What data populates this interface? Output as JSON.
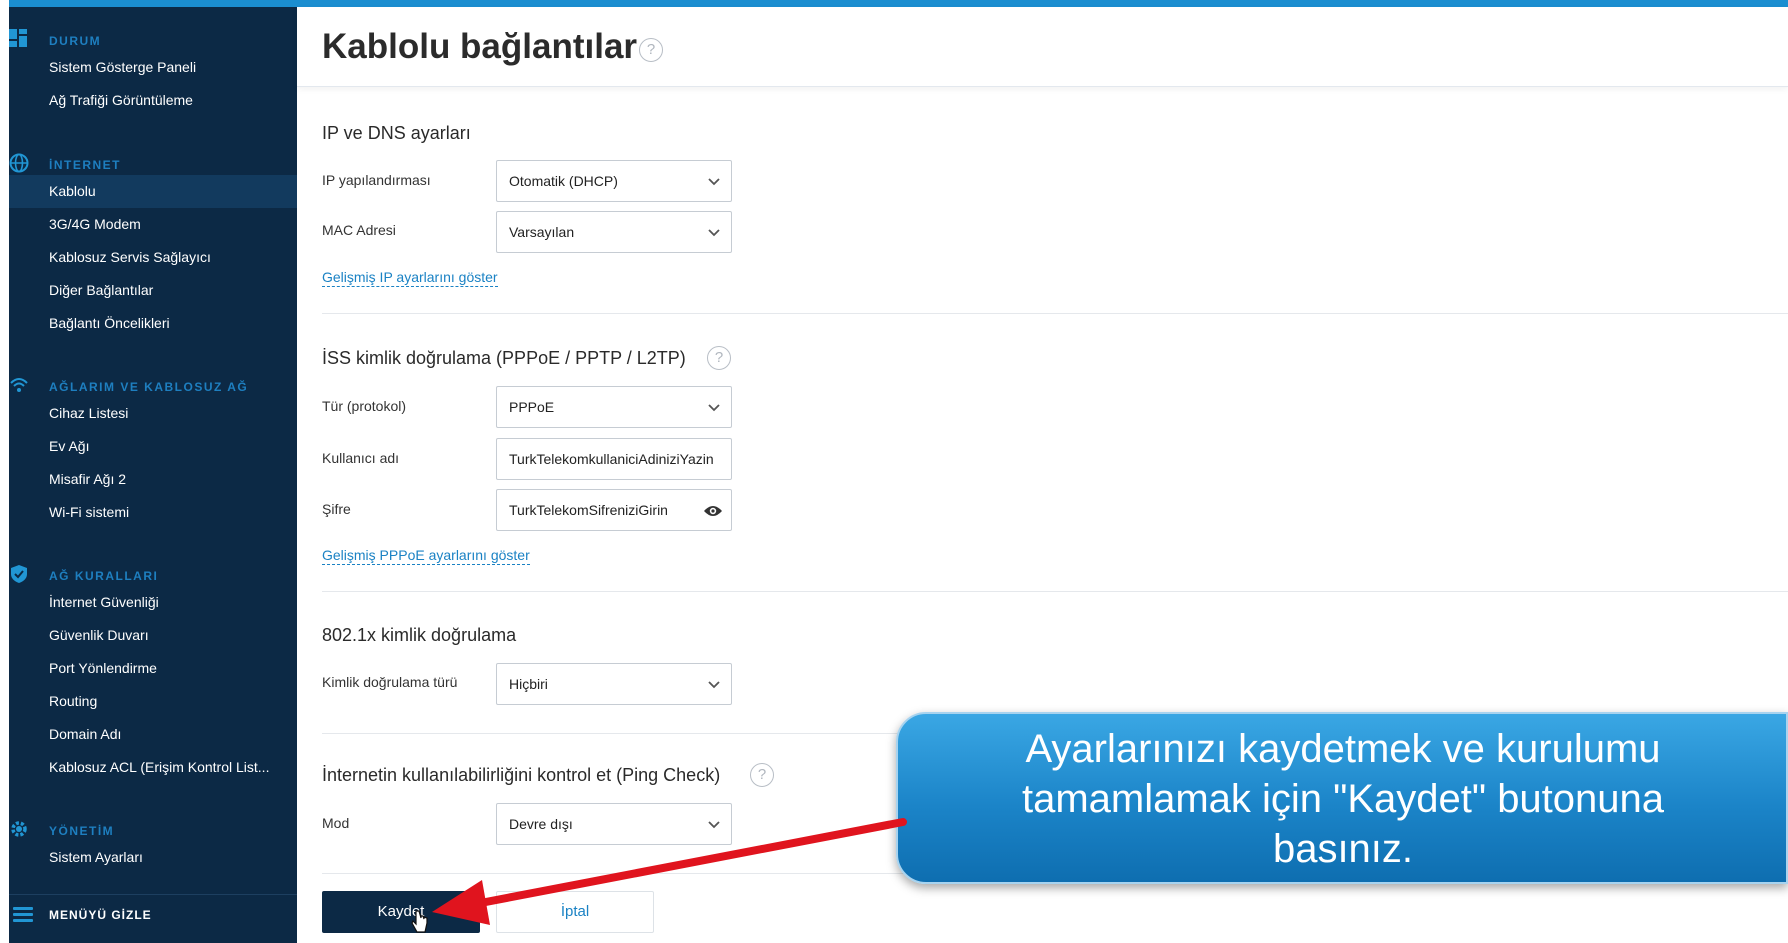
{
  "colors": {
    "sidebar_bg": "#0c2945",
    "accent": "#1b8ed0",
    "section_label": "#1e7fc0",
    "link": "#1a82c4",
    "save_button": "#0c2945"
  },
  "sidebar": {
    "sections": [
      {
        "title": "DURUM",
        "icon": "dashboard-icon",
        "items": [
          "Sistem Gösterge Paneli",
          "Ağ Trafiği Görüntüleme"
        ]
      },
      {
        "title": "İNTERNET",
        "icon": "globe-icon",
        "items": [
          "Kablolu",
          "3G/4G Modem",
          "Kablosuz Servis Sağlayıcı",
          "Diğer Bağlantılar",
          "Bağlantı Öncelikleri"
        ]
      },
      {
        "title": "AĞLARIM VE KABLOSUZ AĞ",
        "icon": "wifi-icon",
        "items": [
          "Cihaz Listesi",
          "Ev Ağı",
          "Misafir Ağı 2",
          "Wi-Fi sistemi"
        ]
      },
      {
        "title": "AĞ KURALLARI",
        "icon": "shield-icon",
        "items": [
          "İnternet Güvenliği",
          "Güvenlik Duvarı",
          "Port Yönlendirme",
          "Routing",
          "Domain Adı",
          "Kablosuz ACL (Erişim Kontrol List..."
        ]
      },
      {
        "title": "YÖNETİM",
        "icon": "gear-icon",
        "items": [
          "Sistem Ayarları"
        ]
      }
    ],
    "active_item": "Kablolu",
    "hide_menu": "MENÜYÜ GİZLE"
  },
  "page": {
    "title": "Kablolu bağlantılar",
    "help_glyph": "?",
    "ip_dns": {
      "title": "IP ve DNS ayarları",
      "ip_config_label": "IP yapılandırması",
      "ip_config_value": "Otomatik (DHCP)",
      "mac_label": "MAC Adresi",
      "mac_value": "Varsayılan",
      "advanced_link": "Gelişmiş IP ayarlarını göster"
    },
    "isp_auth": {
      "title": "İSS kimlik doğrulama (PPPoE / PPTP / L2TP)",
      "type_label": "Tür (protokol)",
      "type_value": "PPPoE",
      "username_label": "Kullanıcı adı",
      "username_value": "TurkTelekomkullaniciAdiniziYazin",
      "password_label": "Şifre",
      "password_value": "TurkTelekomSifreniziGirin",
      "advanced_link": "Gelişmiş PPPoE ayarlarını göster"
    },
    "dot1x": {
      "title": "802.1x kimlik doğrulama",
      "auth_type_label": "Kimlik doğrulama türü",
      "auth_type_value": "Hiçbiri"
    },
    "ping_check": {
      "title": "İnternetin kullanılabilirliğini kontrol et (Ping Check)",
      "mode_label": "Mod",
      "mode_value": "Devre dışı"
    },
    "buttons": {
      "save": "Kaydet",
      "cancel": "İptal"
    }
  },
  "callout": {
    "line1": "Ayarlarınızı kaydetmek ve kurulumu",
    "line2": "tamamlamak için \"Kaydet\" butonuna",
    "line3": "basınız."
  }
}
